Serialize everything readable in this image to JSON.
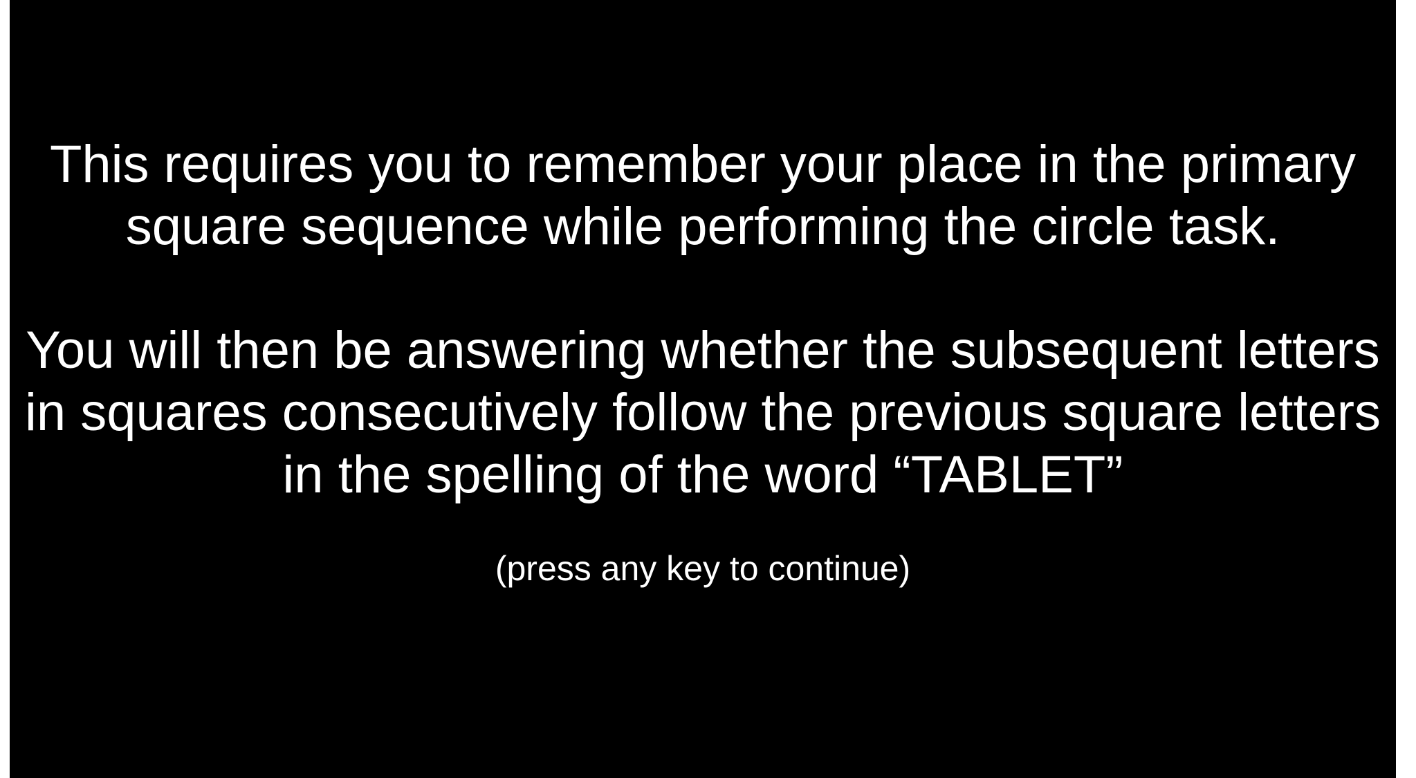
{
  "instructions": {
    "paragraph_1": [
      "This requires you to remember your place in the primary",
      "square sequence while performing the circle task."
    ],
    "paragraph_2": [
      "You will then be answering whether the subsequent letters",
      "in squares consecutively follow the previous square letters",
      "in the spelling of the word “TABLET”"
    ]
  },
  "prompt": "(press any key to continue)",
  "colors": {
    "background": "#000000",
    "text": "#ffffff"
  }
}
